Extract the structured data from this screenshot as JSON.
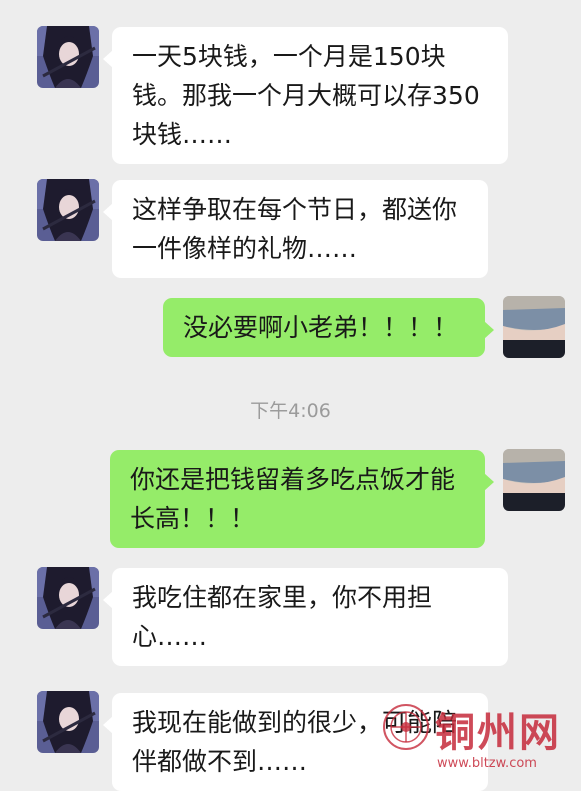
{
  "messages": [
    {
      "side": "left",
      "text": "一天5块钱，一个月是150块钱。那我一个月大概可以存350块钱……"
    },
    {
      "side": "left",
      "text": "这样争取在每个节日，都送你一件像样的礼物……"
    },
    {
      "side": "right",
      "text": "没必要啊小老弟！！！！"
    },
    {
      "side": "right",
      "text": "你还是把钱留着多吃点饭才能长高！！！"
    },
    {
      "side": "left",
      "text": "我吃住都在家里，你不用担心……"
    },
    {
      "side": "left",
      "text": "我现在能做到的很少，可能陪伴都做不到……"
    }
  ],
  "timestamp": "下午4:06",
  "watermark": {
    "title": "铜州网",
    "url": "www.bltzw.com"
  },
  "colors": {
    "background": "#ededed",
    "incoming_bubble": "#ffffff",
    "outgoing_bubble": "#95ec69",
    "watermark": "#c62b3b"
  }
}
